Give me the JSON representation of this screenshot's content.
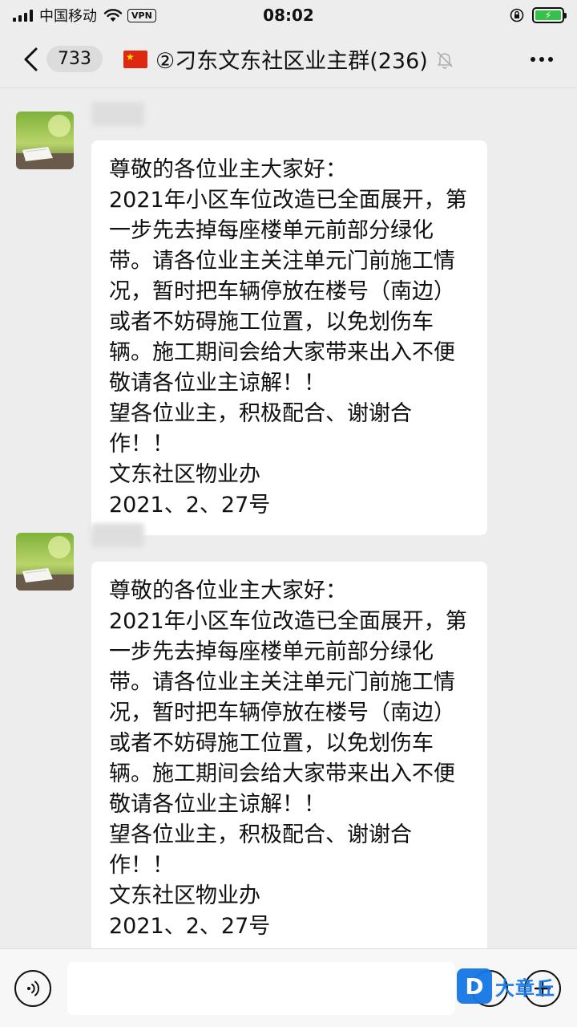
{
  "status_bar": {
    "carrier": "中国移动",
    "vpn": "VPN",
    "time": "08:02"
  },
  "nav": {
    "unread_count": "733",
    "title": "②刁东文东社区业主群(236)"
  },
  "messages": [
    {
      "text": "尊敬的各位业主大家好：\n2021年小区车位改造已全面展开，第一步先去掉每座楼单元前部分绿化带。请各位业主关注单元门前施工情况，暂时把车辆停放在楼号（南边）或者不妨碍施工位置，以免划伤车辆。施工期间会给大家带来出入不便敬请各位业主谅解！！\n望各位业主，积极配合、谢谢合作！！\n文东社区物业办\n2021、2、27号"
    },
    {
      "text": "尊敬的各位业主大家好：\n2021年小区车位改造已全面展开，第一步先去掉每座楼单元前部分绿化带。请各位业主关注单元门前施工情况，暂时把车辆停放在楼号（南边）或者不妨碍施工位置，以免划伤车辆。施工期间会给大家带来出入不便敬请各位业主谅解！！\n望各位业主，积极配合、谢谢合作！！\n文东社区物业办\n2021、2、27号"
    }
  ],
  "watermark": {
    "text": "大章丘",
    "color": "#1677e6"
  },
  "colors": {
    "background": "#ededed",
    "bubble": "#ffffff",
    "battery": "#36c24a"
  }
}
